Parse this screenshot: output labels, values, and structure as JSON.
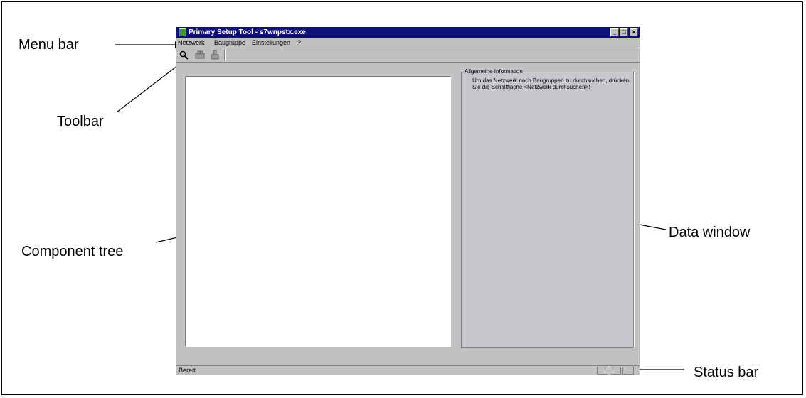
{
  "annotations": {
    "menu_bar": "Menu bar",
    "toolbar": "Toolbar",
    "component_tree": "Component tree",
    "data_window": "Data window",
    "status_bar": "Status bar"
  },
  "window": {
    "title": "Primary Setup Tool - s7wnpstx.exe",
    "app_icon": "app-icon",
    "controls": {
      "minimize": "_",
      "maximize": "□",
      "close": "×"
    },
    "title_bar_color": "#10107a"
  },
  "menu": {
    "items": [
      "Netzwerk",
      "Baugruppe",
      "Einstellungen",
      "?"
    ]
  },
  "toolbar": {
    "tools": [
      "browse-network-icon",
      "module-icon",
      "settings-icon"
    ]
  },
  "data_window": {
    "group_title": "Allgemeine Information",
    "text": "Um das Netzwerk nach Baugruppen zu durchsuchen, drücken Sie die Schaltfläche <Netzwerk durchsuchen>!"
  },
  "status_bar": {
    "text": "Bereit"
  }
}
